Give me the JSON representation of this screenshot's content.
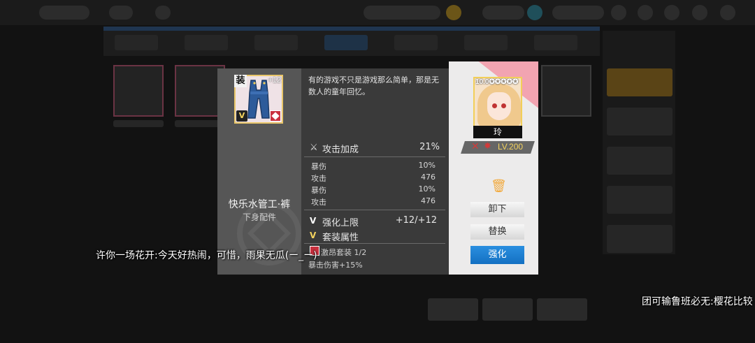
{
  "item": {
    "name": "快乐水管工·裤",
    "type": "下身配件",
    "slot_badge": "装",
    "enhance_badge": "+12",
    "grade_badge": "V",
    "description": "有的游戏不只是游戏那么简单，那是无数人的童年回忆。",
    "main_stat": {
      "label": "攻击加成",
      "value": "21%",
      "icon": "sword-icon"
    },
    "sub_stats": [
      {
        "label": "暴伤",
        "value": "10%"
      },
      {
        "label": "攻击",
        "value": "476"
      },
      {
        "label": "暴伤",
        "value": "10%"
      },
      {
        "label": "攻击",
        "value": "476"
      }
    ],
    "enhance_limit": {
      "badge": "V",
      "label": "强化上限",
      "value": "+12/+12"
    },
    "set": {
      "badge": "V",
      "label": "套装属性",
      "set_name": "激昂套装 1/2",
      "bonus": "暴击伤害+15%"
    }
  },
  "character": {
    "level_tag": "10.0✪✪✪✪✪",
    "name": "玲",
    "level": "LV.200"
  },
  "buttons": {
    "unequip": "卸下",
    "replace": "替换",
    "enhance": "强化"
  },
  "danmaku": [
    "许你一场花开:今天好热闹，可惜，雨果无瓜(ー_ー)",
    "团可输鲁班必无:樱花比较"
  ],
  "colors": {
    "accent_blue": "#1a7fd4",
    "pink": "#f39cab",
    "gold": "#f2cf58"
  }
}
